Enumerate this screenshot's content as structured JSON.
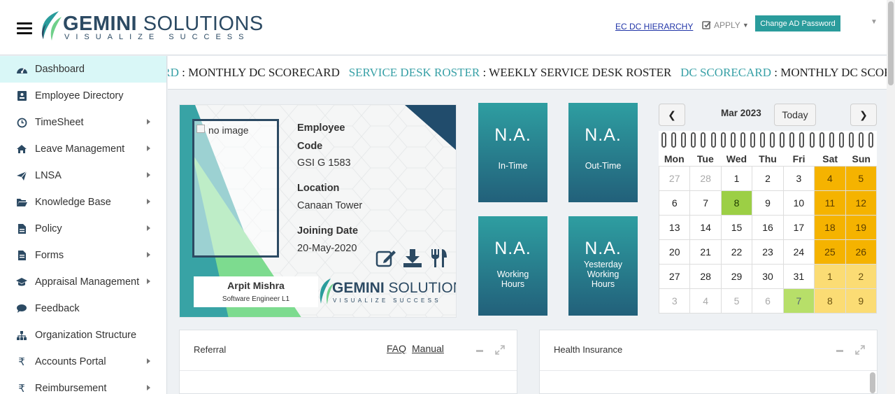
{
  "header": {
    "logo_main": "GEMINI",
    "logo_rest": "SOLUTIONS",
    "logo_tagline": "VISUALIZE SUCCESS",
    "link_hierarchy": "EC DC HIERARCHY",
    "apply_label": "APPLY",
    "change_password": "Change AD Password"
  },
  "sidebar": {
    "items": [
      {
        "label": "Dashboard",
        "icon": "dashboard-icon"
      },
      {
        "label": "Employee Directory",
        "icon": "id-card-icon"
      },
      {
        "label": "TimeSheet",
        "icon": "clock-icon"
      },
      {
        "label": "Leave Management",
        "icon": "home-icon"
      },
      {
        "label": "LNSA",
        "icon": "paper-plane-icon"
      },
      {
        "label": "Knowledge Base",
        "icon": "folder-icon"
      },
      {
        "label": "Policy",
        "icon": "document-icon"
      },
      {
        "label": "Forms",
        "icon": "form-icon"
      },
      {
        "label": "Appraisal Management",
        "icon": "graduation-cap-icon"
      },
      {
        "label": "Feedback",
        "icon": "chat-icon"
      },
      {
        "label": "Organization Structure",
        "icon": "sitemap-icon"
      },
      {
        "label": "Accounts Portal",
        "icon": "rupee-icon"
      },
      {
        "label": "Reimbursement",
        "icon": "rupee-icon"
      }
    ]
  },
  "marquee": {
    "items": [
      {
        "key": "DC SCORECARD",
        "value": "MONTHLY DC SCORECARD"
      },
      {
        "key": "SERVICE DESK ROSTER",
        "value": "WEEKLY SERVICE DESK ROSTER"
      },
      {
        "key": "DC SCORECARD",
        "value": "MONTHLY DC SCORECARD"
      }
    ],
    "separator": " : "
  },
  "profile": {
    "image_alt": "no image",
    "code_label_1": "Employee",
    "code_label_2": "Code",
    "code_value": "GSI G 1583",
    "location_label": "Location",
    "location_value": "Canaan Tower",
    "joining_label": "Joining Date",
    "joining_value": "20-May-2020",
    "name": "Arpit Mishra",
    "role": "Software Engineer L1",
    "logo_main": "GEMINI",
    "logo_rest": "SOLUTIONS",
    "logo_tagline": "VISUALIZE SUCCESS"
  },
  "tiles": [
    {
      "value": "N.A.",
      "label": "In-Time"
    },
    {
      "value": "N.A.",
      "label": "Out-Time"
    },
    {
      "value": "N.A.",
      "label": "Working Hours"
    },
    {
      "value": "N.A.",
      "label": "Yesterday Working Hours"
    }
  ],
  "calendar": {
    "title": "Mar 2023",
    "today_label": "Today",
    "prev": "❮",
    "next": "❯",
    "weekdays": [
      "Mon",
      "Tue",
      "Wed",
      "Thu",
      "Fri",
      "Sat",
      "Sun"
    ],
    "days": [
      {
        "d": "27",
        "s": "muted"
      },
      {
        "d": "28",
        "s": "muted"
      },
      {
        "d": "1",
        "s": ""
      },
      {
        "d": "2",
        "s": ""
      },
      {
        "d": "3",
        "s": ""
      },
      {
        "d": "4",
        "s": "wk"
      },
      {
        "d": "5",
        "s": "wk"
      },
      {
        "d": "6",
        "s": ""
      },
      {
        "d": "7",
        "s": ""
      },
      {
        "d": "8",
        "s": "today"
      },
      {
        "d": "9",
        "s": ""
      },
      {
        "d": "10",
        "s": ""
      },
      {
        "d": "11",
        "s": "wk"
      },
      {
        "d": "12",
        "s": "wk"
      },
      {
        "d": "13",
        "s": ""
      },
      {
        "d": "14",
        "s": ""
      },
      {
        "d": "15",
        "s": ""
      },
      {
        "d": "16",
        "s": ""
      },
      {
        "d": "17",
        "s": ""
      },
      {
        "d": "18",
        "s": "wk"
      },
      {
        "d": "19",
        "s": "wk"
      },
      {
        "d": "20",
        "s": ""
      },
      {
        "d": "21",
        "s": ""
      },
      {
        "d": "22",
        "s": ""
      },
      {
        "d": "23",
        "s": ""
      },
      {
        "d": "24",
        "s": ""
      },
      {
        "d": "25",
        "s": "wk"
      },
      {
        "d": "26",
        "s": "wk"
      },
      {
        "d": "27",
        "s": ""
      },
      {
        "d": "28",
        "s": ""
      },
      {
        "d": "29",
        "s": ""
      },
      {
        "d": "30",
        "s": ""
      },
      {
        "d": "31",
        "s": ""
      },
      {
        "d": "1",
        "s": "wkl"
      },
      {
        "d": "2",
        "s": "wkl"
      },
      {
        "d": "3",
        "s": "muted"
      },
      {
        "d": "4",
        "s": "muted"
      },
      {
        "d": "5",
        "s": "muted"
      },
      {
        "d": "6",
        "s": "muted"
      },
      {
        "d": "7",
        "s": "hl"
      },
      {
        "d": "8",
        "s": "wkl"
      },
      {
        "d": "9",
        "s": "wkl"
      }
    ]
  },
  "panels": {
    "referral": {
      "title": "Referral",
      "faq": "FAQ",
      "manual": "Manual"
    },
    "health": {
      "title": "Health Insurance"
    }
  },
  "colors": {
    "brand_teal": "#2a9c9c",
    "brand_navy": "#2c4a63",
    "weekend": "#f5b300",
    "today": "#9ccf45"
  }
}
